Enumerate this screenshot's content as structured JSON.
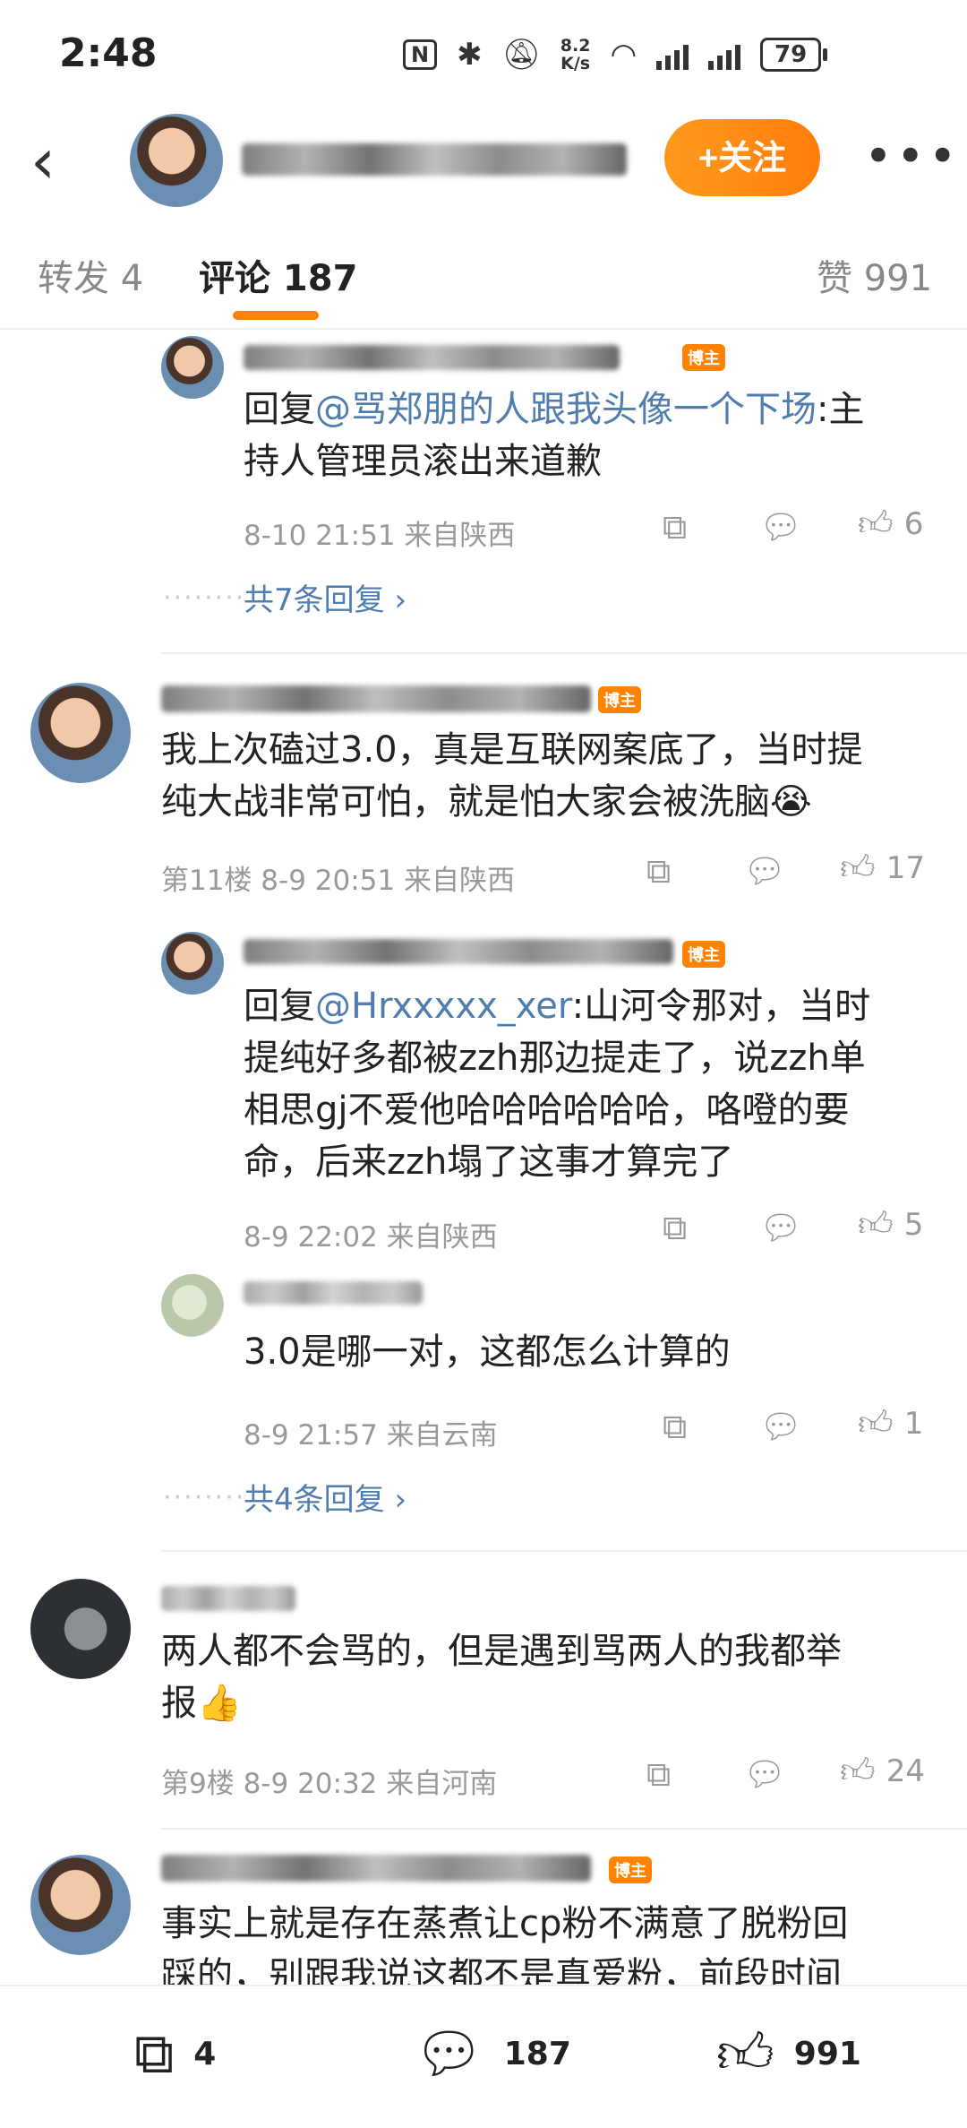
{
  "status_bar": {
    "time": "2:48",
    "nfc_label": "N",
    "net_speed": "8.2\nK/s",
    "battery": "79"
  },
  "header": {
    "follow_label": "+关注",
    "more_label": "•••"
  },
  "tabs": {
    "repost": "转发 4",
    "comments": "评论 187",
    "likes": "赞 991"
  },
  "comments": {
    "reply_a": {
      "text_prefix": "回复",
      "mention": "@骂郑朋的人跟我头像一个下场",
      "text_line1_tail": ":主",
      "text_line2": "持人管理员滚出来道歉",
      "time_loc": "8-10 21:51  来自陕西",
      "likes": "6",
      "more_replies": "共7条回复 ›",
      "badge": "博主"
    },
    "floor11": {
      "text_line1": "我上次磕过3.0，真是互联网案底了，当时提",
      "text_line2": "纯大战非常可怕，就是怕大家会被洗脑😭",
      "meta": "第11楼  8-9 20:51  来自陕西",
      "likes": "17",
      "badge": "博主"
    },
    "reply_b": {
      "text_prefix": "回复",
      "mention": "@Hrxxxxx_xer",
      "text_line1_tail": ":山河令那对，当时",
      "text_line2": "提纯好多都被zzh那边提走了，说zzh单",
      "text_line3": "相思gj不爱他哈哈哈哈哈哈，咯噔的要",
      "text_line4": "命，后来zzh塌了这事才算完了",
      "time_loc": "8-9 22:02  来自陕西",
      "likes": "5",
      "badge": "博主"
    },
    "reply_c": {
      "text": "3.0是哪一对，这都怎么计算的",
      "time_loc": "8-9 21:57  来自云南",
      "likes": "1",
      "more_replies": "共4条回复 ›"
    },
    "floor9": {
      "text_line1": "两人都不会骂的，但是遇到骂两人的我都举",
      "text_line2": "报👍",
      "meta": "第9楼  8-9 20:32  来自河南",
      "likes": "24"
    },
    "floor_next": {
      "text_line1": "事实上就是存在蒸煮让cp粉不满意了脱粉回",
      "text_line2": "踩的，别跟我说这都不是真爱粉，前段时间",
      "badge": "博主"
    }
  },
  "bottom_bar": {
    "repost_count": "4",
    "comment_count": "187",
    "like_count": "991"
  },
  "colors": {
    "accent": "#ff8200",
    "link": "#507daf",
    "muted": "#999999"
  },
  "icons": [
    "back-arrow-icon",
    "share-icon",
    "comment-icon",
    "like-icon",
    "more-icon",
    "bluetooth-icon",
    "mute-icon",
    "wifi-icon",
    "signal-icon"
  ]
}
